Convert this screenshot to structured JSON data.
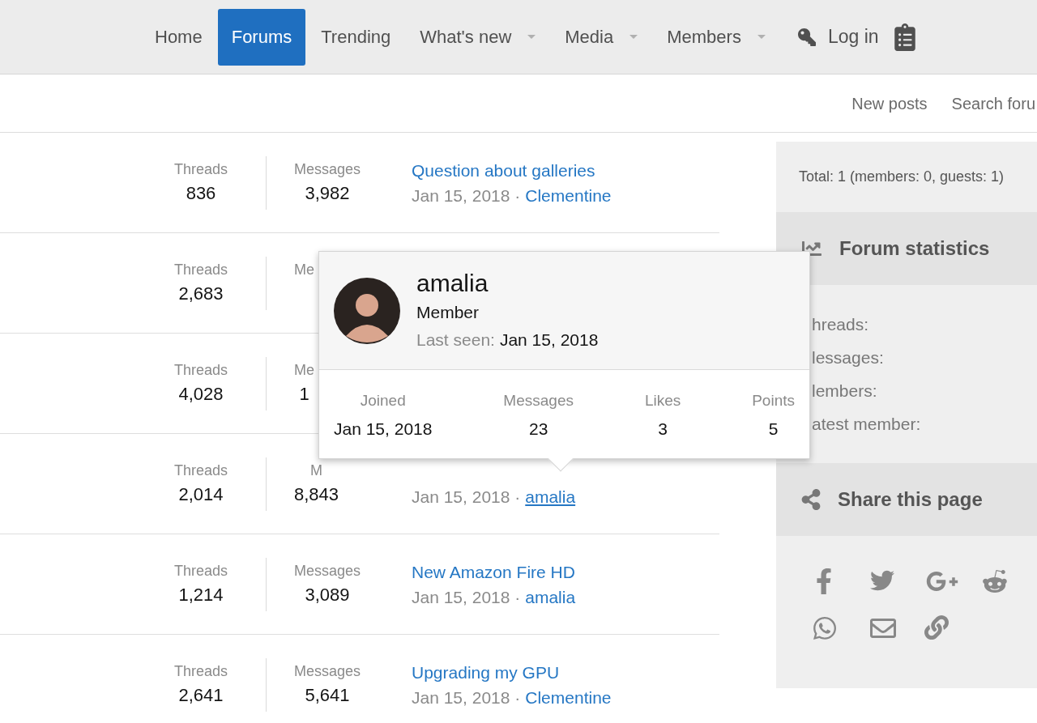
{
  "nav": {
    "items": [
      {
        "label": "Home",
        "selected": false,
        "dropdown": false
      },
      {
        "label": "Forums",
        "selected": true,
        "dropdown": false
      },
      {
        "label": "Trending",
        "selected": false,
        "dropdown": false
      },
      {
        "label": "What's new",
        "selected": false,
        "dropdown": true
      },
      {
        "label": "Media",
        "selected": false,
        "dropdown": true
      },
      {
        "label": "Members",
        "selected": false,
        "dropdown": true
      }
    ],
    "login": "Log in"
  },
  "subnav": [
    "New posts",
    "Search foru"
  ],
  "forums": [
    {
      "threads_label": "Threads",
      "threads": "836",
      "messages_label": "Messages",
      "messages": "3,982",
      "latest_title": "Question about galleries",
      "latest_date": "Jan 15, 2018 ·",
      "latest_user": "Clementine",
      "user_hovered": false
    },
    {
      "threads_label": "Threads",
      "threads": "2,683",
      "messages_label": "Me"
    },
    {
      "threads_label": "Threads",
      "threads": "4,028",
      "messages_label": "Me",
      "messages": "1"
    },
    {
      "threads_label": "Threads",
      "threads": "2,014",
      "messages_label": "M",
      "messages": "8,843",
      "latest_date": "Jan 15, 2018 ·",
      "latest_user": "amalia",
      "user_hovered": true
    },
    {
      "threads_label": "Threads",
      "threads": "1,214",
      "messages_label": "Messages",
      "messages": "3,089",
      "latest_title": "New Amazon Fire HD",
      "latest_date": "Jan 15, 2018 ·",
      "latest_user": "amalia",
      "user_hovered": false
    },
    {
      "threads_label": "Threads",
      "threads": "2,641",
      "messages_label": "Messages",
      "messages": "5,641",
      "latest_title": "Upgrading my GPU",
      "latest_date": "Jan 15, 2018 ·",
      "latest_user": "Clementine",
      "user_hovered": false
    }
  ],
  "popup": {
    "name": "amalia",
    "title": "Member",
    "last_seen_label": "Last seen:",
    "last_seen": "Jan 15, 2018",
    "stats": [
      {
        "label": "Joined",
        "value": "Jan 15, 2018"
      },
      {
        "label": "Messages",
        "value": "23"
      },
      {
        "label": "Likes",
        "value": "3"
      },
      {
        "label": "Points",
        "value": "5"
      }
    ]
  },
  "sidebar": {
    "online_total": "Total: 1 (members: 0, guests: 1)",
    "statistics": {
      "title": "Forum statistics",
      "labels": [
        "hreads:",
        "lessages:",
        "lembers:",
        "atest member:"
      ]
    },
    "share": {
      "title": "Share this page"
    }
  }
}
